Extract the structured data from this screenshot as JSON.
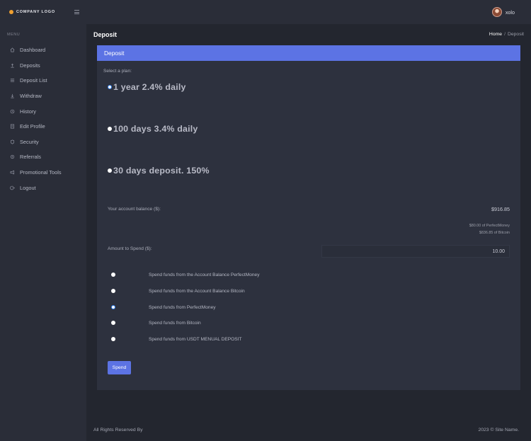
{
  "brand": {
    "logo_text": "COMPANY LOGO"
  },
  "sidebar": {
    "menu_title": "MENU",
    "items": [
      {
        "label": "Dashboard",
        "icon": "home-icon"
      },
      {
        "label": "Deposits",
        "icon": "upload-icon"
      },
      {
        "label": "Deposit List",
        "icon": "list-icon"
      },
      {
        "label": "Withdraw",
        "icon": "download-icon"
      },
      {
        "label": "History",
        "icon": "history-icon"
      },
      {
        "label": "Edit Profile",
        "icon": "profile-icon"
      },
      {
        "label": "Security",
        "icon": "shield-icon"
      },
      {
        "label": "Referrals",
        "icon": "referral-icon"
      },
      {
        "label": "Promotional Tools",
        "icon": "megaphone-icon"
      },
      {
        "label": "Logout",
        "icon": "logout-icon"
      }
    ]
  },
  "header": {
    "username": "xolo"
  },
  "page": {
    "title": "Deposit",
    "breadcrumb": {
      "home": "Home",
      "separator": "/",
      "current": "Deposit"
    }
  },
  "card": {
    "title": "Deposit",
    "select_label": "Select a plan:",
    "plans": [
      {
        "name": "1 year 2.4% daily",
        "selected": true
      },
      {
        "name": "100 days 3.4% daily",
        "selected": false
      },
      {
        "name": "30 days deposit. 150%",
        "selected": false
      }
    ],
    "balance": {
      "label": "Your account balance ($):",
      "value": "$916.85",
      "breakdown": [
        "$80.00 of PerfectMoney",
        "$836.85 of Bitcoin"
      ]
    },
    "amount": {
      "label": "Amount to Spend ($):",
      "value": "10.00"
    },
    "funding_options": [
      {
        "label": "Spend funds from the Account Balance PerfectMoney",
        "selected": false
      },
      {
        "label": "Spend funds from the Account Balance Bitcoin",
        "selected": false
      },
      {
        "label": "Spend funds from PerfectMoney",
        "selected": true
      },
      {
        "label": "Spend funds from Bitcoin",
        "selected": false
      },
      {
        "label": "Spend funds from USDT MENUAL DEPOSIT",
        "selected": false
      }
    ],
    "submit_label": "Spend"
  },
  "footer": {
    "left": "All Rights Reserved By",
    "right": "2023 © Site Name."
  },
  "colors": {
    "accent": "#5c73e4",
    "radio_selected": "#2f7ff0",
    "logo_dot": "#f0a030"
  }
}
